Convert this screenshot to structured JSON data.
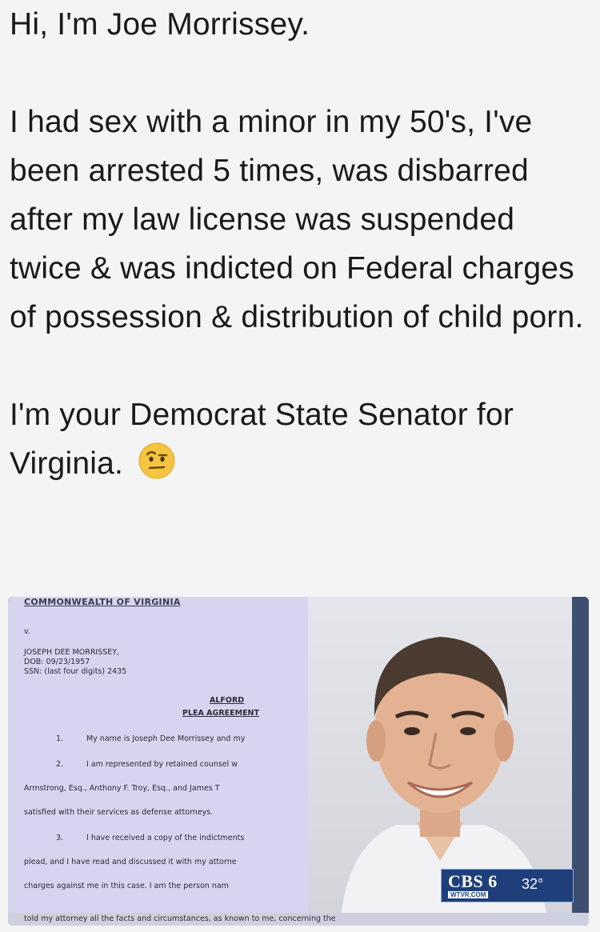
{
  "post": {
    "line1": "Hi, I'm Joe Morrissey.",
    "para2": "I had sex with a minor in my 50's, I've been arrested 5 times, was disbarred after my law license was suspended twice & was indicted on Federal charges of possession & distribution of child porn.",
    "para3": "I'm your Democrat State Senator for Virginia.",
    "emoji": "raised-eyebrow-emoji-icon"
  },
  "document": {
    "header": "COMMONWEALTH OF VIRGINIA",
    "v": "v.",
    "defendant": "JOSEPH DEE MORRISSEY,",
    "dob": "DOB: 09/23/1957",
    "ssn": "SSN: (last four digits) 2435",
    "title1": "ALFORD",
    "title2": "PLEA AGREEMENT",
    "lines": [
      {
        "num": "1.",
        "text": "My name is Joseph Dee Morrissey and my"
      },
      {
        "num": "2.",
        "text": "I am represented by retained counsel w"
      },
      {
        "num": "",
        "text": "Armstrong, Esq., Anthony F. Troy, Esq., and James T"
      },
      {
        "num": "",
        "text": "satisfied with their services as defense attorneys."
      },
      {
        "num": "3.",
        "text": "I have received a copy of the indictments"
      },
      {
        "num": "",
        "text": "plead, and I have read and discussed it with my attorne"
      },
      {
        "num": "",
        "text": "charges against me in this case. I am the person nam"
      },
      {
        "num": "",
        "text": "told my attorney all the facts and circumstances, as known to me, concerning the"
      }
    ]
  },
  "broadcast": {
    "brand": "CBS 6",
    "site": "WTVR.COM",
    "temperature": "32°"
  }
}
